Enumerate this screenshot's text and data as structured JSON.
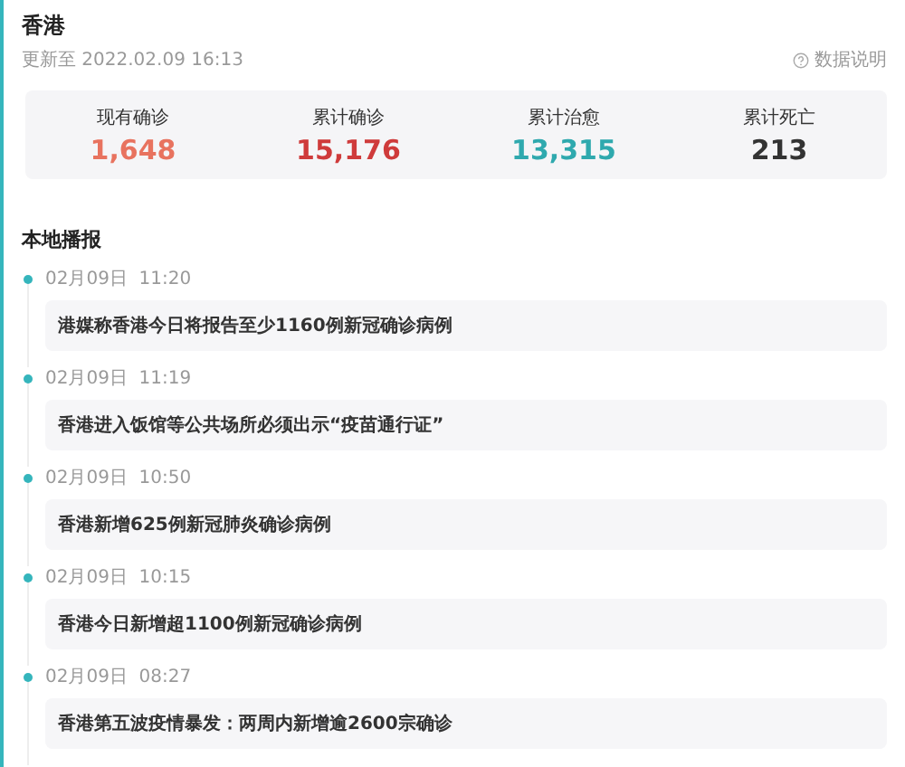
{
  "region": {
    "title": "香港",
    "updated": "更新至 2022.02.09 16:13",
    "help_link": "数据说明"
  },
  "stats": [
    {
      "label": "现有确诊",
      "value": "1,648",
      "color": "#e8735f"
    },
    {
      "label": "累计确诊",
      "value": "15,176",
      "color": "#cf3b3b"
    },
    {
      "label": "累计治愈",
      "value": "13,315",
      "color": "#2fa9ae"
    },
    {
      "label": "累计死亡",
      "value": "213",
      "color": "#333333"
    }
  ],
  "feed": {
    "title": "本地播报",
    "items": [
      {
        "time": "02月09日  11:20",
        "text": "港媒称香港今日将报告至少1160例新冠确诊病例"
      },
      {
        "time": "02月09日  11:19",
        "text": "香港进入饭馆等公共场所必须出示“疫苗通行证”"
      },
      {
        "time": "02月09日  10:50",
        "text": "香港新增625例新冠肺炎确诊病例"
      },
      {
        "time": "02月09日  10:15",
        "text": "香港今日新增超1100例新冠确诊病例"
      },
      {
        "time": "02月09日  08:27",
        "text": "香港第五波疫情暴发：两周内新增逾2600宗确诊"
      }
    ]
  }
}
